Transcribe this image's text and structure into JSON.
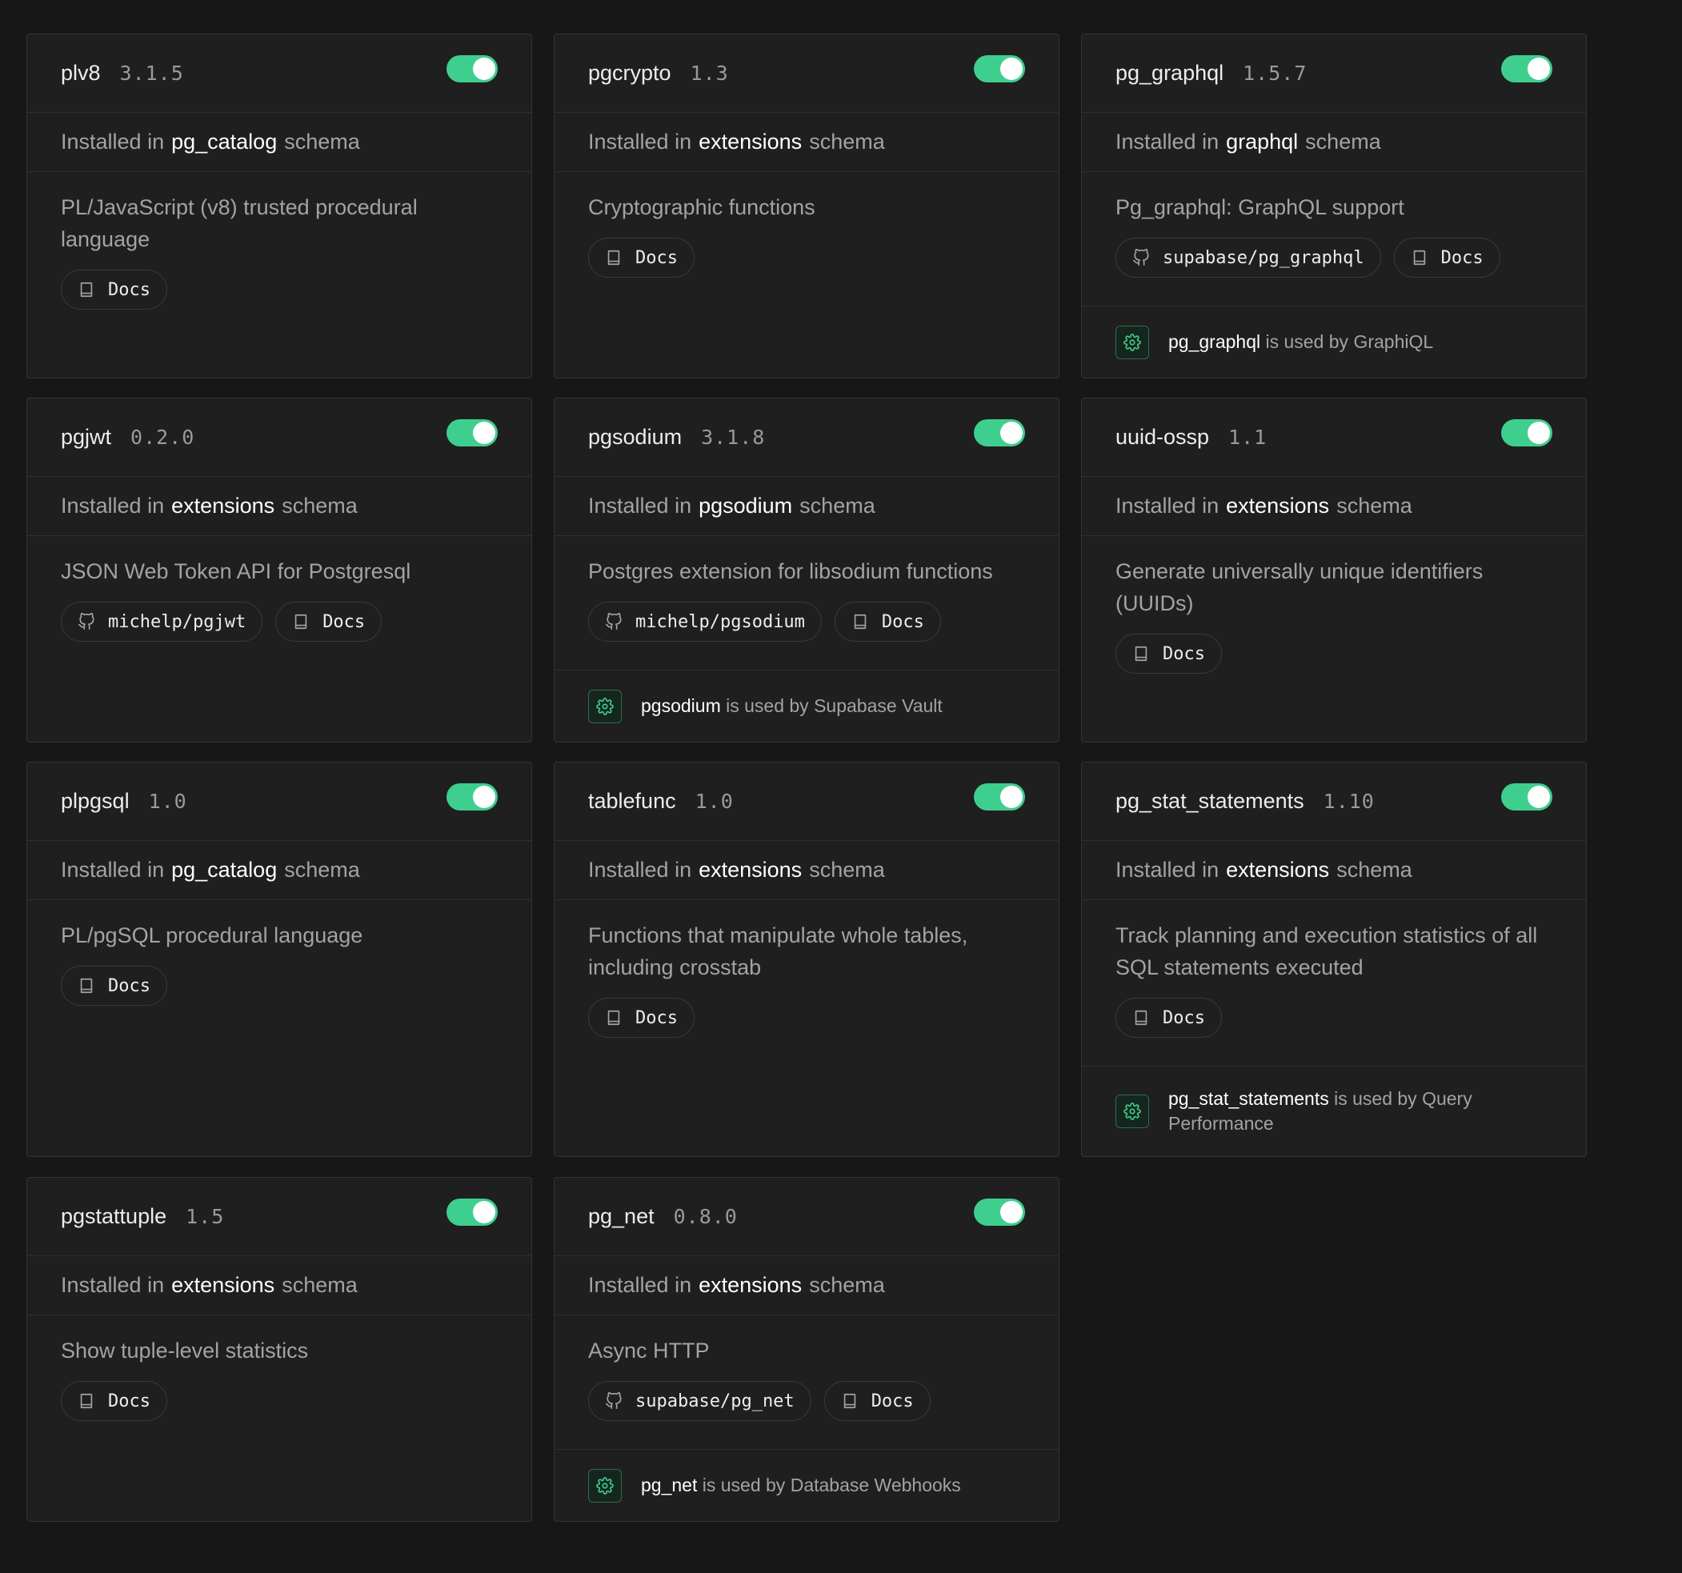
{
  "labels": {
    "installed_in": "Installed in",
    "schema": "schema",
    "docs": "Docs",
    "is_used_by": "is used by"
  },
  "colors": {
    "background": "#171717",
    "card": "#1f1f1f",
    "border": "#333333",
    "accent": "#3ecf8e"
  },
  "extensions": [
    {
      "name": "plv8",
      "version": "3.1.5",
      "enabled": true,
      "schema": "pg_catalog",
      "description": "PL/JavaScript (v8) trusted procedural language",
      "repo": "",
      "used_by": ""
    },
    {
      "name": "pgcrypto",
      "version": "1.3",
      "enabled": true,
      "schema": "extensions",
      "description": "Cryptographic functions",
      "repo": "",
      "used_by": ""
    },
    {
      "name": "pg_graphql",
      "version": "1.5.7",
      "enabled": true,
      "schema": "graphql",
      "description": "Pg_graphql: GraphQL support",
      "repo": "supabase/pg_graphql",
      "used_by": "GraphiQL"
    },
    {
      "name": "pgjwt",
      "version": "0.2.0",
      "enabled": true,
      "schema": "extensions",
      "description": "JSON Web Token API for Postgresql",
      "repo": "michelp/pgjwt",
      "used_by": ""
    },
    {
      "name": "pgsodium",
      "version": "3.1.8",
      "enabled": true,
      "schema": "pgsodium",
      "description": "Postgres extension for libsodium functions",
      "repo": "michelp/pgsodium",
      "used_by": "Supabase Vault"
    },
    {
      "name": "uuid-ossp",
      "version": "1.1",
      "enabled": true,
      "schema": "extensions",
      "description": "Generate universally unique identifiers (UUIDs)",
      "repo": "",
      "used_by": ""
    },
    {
      "name": "plpgsql",
      "version": "1.0",
      "enabled": true,
      "schema": "pg_catalog",
      "description": "PL/pgSQL procedural language",
      "repo": "",
      "used_by": ""
    },
    {
      "name": "tablefunc",
      "version": "1.0",
      "enabled": true,
      "schema": "extensions",
      "description": "Functions that manipulate whole tables, including crosstab",
      "repo": "",
      "used_by": ""
    },
    {
      "name": "pg_stat_statements",
      "version": "1.10",
      "enabled": true,
      "schema": "extensions",
      "description": "Track planning and execution statistics of all SQL statements executed",
      "repo": "",
      "used_by": "Query Performance"
    },
    {
      "name": "pgstattuple",
      "version": "1.5",
      "enabled": true,
      "schema": "extensions",
      "description": "Show tuple-level statistics",
      "repo": "",
      "used_by": ""
    },
    {
      "name": "pg_net",
      "version": "0.8.0",
      "enabled": true,
      "schema": "extensions",
      "description": "Async HTTP",
      "repo": "supabase/pg_net",
      "used_by": "Database Webhooks"
    }
  ]
}
